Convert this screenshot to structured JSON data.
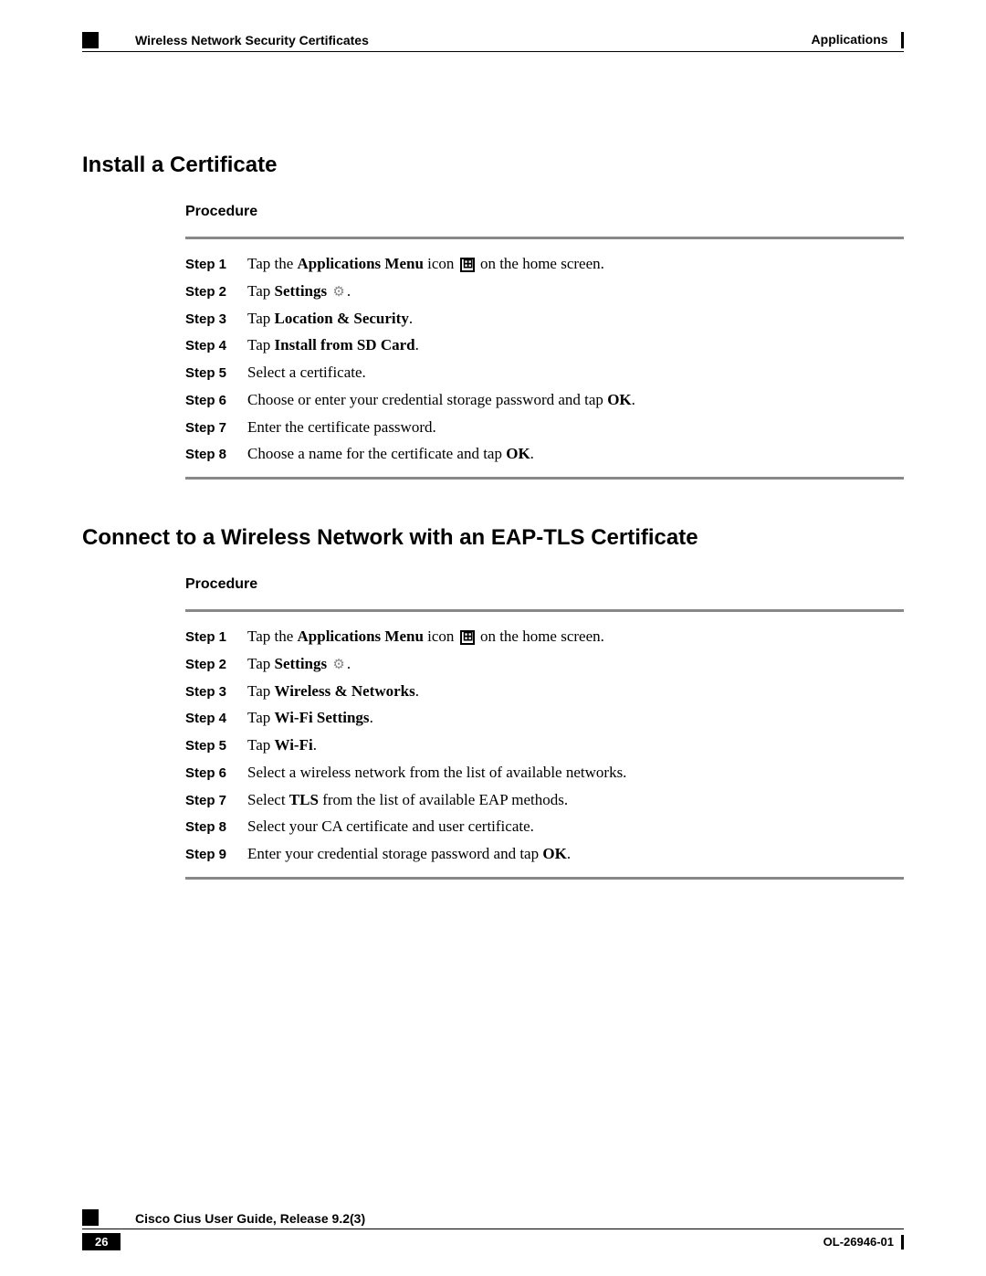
{
  "header": {
    "breadcrumb": "Wireless Network Security Certificates",
    "chapter": "Applications"
  },
  "section1": {
    "title": "Install a Certificate",
    "procedure_label": "Procedure",
    "steps": [
      {
        "label": "Step 1",
        "parts": [
          {
            "t": "Tap the "
          },
          {
            "t": "Applications Menu",
            "b": true
          },
          {
            "t": " icon "
          },
          {
            "icon": "apps"
          },
          {
            "t": " on the home screen."
          }
        ]
      },
      {
        "label": "Step 2",
        "parts": [
          {
            "t": "Tap "
          },
          {
            "t": "Settings",
            "b": true
          },
          {
            "t": " "
          },
          {
            "icon": "gear"
          },
          {
            "t": "."
          }
        ]
      },
      {
        "label": "Step 3",
        "parts": [
          {
            "t": "Tap "
          },
          {
            "t": "Location & Security",
            "b": true
          },
          {
            "t": "."
          }
        ]
      },
      {
        "label": "Step 4",
        "parts": [
          {
            "t": "Tap "
          },
          {
            "t": "Install from SD Card",
            "b": true
          },
          {
            "t": "."
          }
        ]
      },
      {
        "label": "Step 5",
        "parts": [
          {
            "t": "Select a certificate."
          }
        ]
      },
      {
        "label": "Step 6",
        "parts": [
          {
            "t": "Choose or enter your credential storage password and tap "
          },
          {
            "t": "OK",
            "b": true
          },
          {
            "t": "."
          }
        ]
      },
      {
        "label": "Step 7",
        "parts": [
          {
            "t": "Enter the certificate password."
          }
        ]
      },
      {
        "label": "Step 8",
        "parts": [
          {
            "t": "Choose a name for the certificate and tap "
          },
          {
            "t": "OK",
            "b": true
          },
          {
            "t": "."
          }
        ]
      }
    ]
  },
  "section2": {
    "title": "Connect to a Wireless Network with an EAP-TLS Certificate",
    "procedure_label": "Procedure",
    "steps": [
      {
        "label": "Step 1",
        "parts": [
          {
            "t": "Tap the "
          },
          {
            "t": "Applications Menu",
            "b": true
          },
          {
            "t": " icon "
          },
          {
            "icon": "apps"
          },
          {
            "t": " on the home screen."
          }
        ]
      },
      {
        "label": "Step 2",
        "parts": [
          {
            "t": "Tap "
          },
          {
            "t": "Settings",
            "b": true
          },
          {
            "t": " "
          },
          {
            "icon": "gear"
          },
          {
            "t": "."
          }
        ]
      },
      {
        "label": "Step 3",
        "parts": [
          {
            "t": "Tap "
          },
          {
            "t": "Wireless & Networks",
            "b": true
          },
          {
            "t": "."
          }
        ]
      },
      {
        "label": "Step 4",
        "parts": [
          {
            "t": "Tap "
          },
          {
            "t": "Wi-Fi Settings",
            "b": true
          },
          {
            "t": "."
          }
        ]
      },
      {
        "label": "Step 5",
        "parts": [
          {
            "t": "Tap "
          },
          {
            "t": "Wi-Fi",
            "b": true
          },
          {
            "t": "."
          }
        ]
      },
      {
        "label": "Step 6",
        "parts": [
          {
            "t": "Select a wireless network from the list of available networks."
          }
        ]
      },
      {
        "label": "Step 7",
        "parts": [
          {
            "t": "Select "
          },
          {
            "t": "TLS",
            "b": true
          },
          {
            "t": " from the list of available EAP methods."
          }
        ]
      },
      {
        "label": "Step 8",
        "parts": [
          {
            "t": "Select your CA certificate and user certificate."
          }
        ]
      },
      {
        "label": "Step 9",
        "parts": [
          {
            "t": "Enter your credential storage password and tap "
          },
          {
            "t": "OK",
            "b": true
          },
          {
            "t": "."
          }
        ]
      }
    ]
  },
  "footer": {
    "title": "Cisco Cius User Guide, Release 9.2(3)",
    "page_number": "26",
    "doc_id": "OL-26946-01"
  }
}
